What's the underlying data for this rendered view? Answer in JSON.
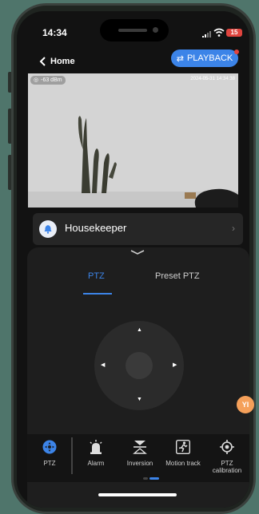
{
  "status_bar": {
    "time": "14:34",
    "battery": "15"
  },
  "nav": {
    "back_label": "Home",
    "playback_label": "PLAYBACK"
  },
  "video": {
    "rssi": "-63 dBm",
    "timestamp": "2024-05-31 14:34:38"
  },
  "housekeeper": {
    "label": "Housekeeper"
  },
  "ptz_panel": {
    "tabs": [
      "PTZ",
      "Preset PTZ"
    ],
    "selected_tab": "PTZ"
  },
  "toolbar": {
    "items": [
      {
        "label": "PTZ",
        "icon": "ptz-icon"
      },
      {
        "label": "Alarm",
        "icon": "alarm-icon"
      },
      {
        "label": "Inversion",
        "icon": "inversion-icon"
      },
      {
        "label": "Motion track",
        "icon": "motion-track-icon"
      },
      {
        "label": "PTZ\ncalibration",
        "icon": "ptz-calibration-icon"
      }
    ]
  },
  "floating_button": {
    "label": "YI"
  },
  "colors": {
    "accent": "#3c84e8",
    "background": "#4f756b",
    "panel": "#1e1e1e"
  }
}
